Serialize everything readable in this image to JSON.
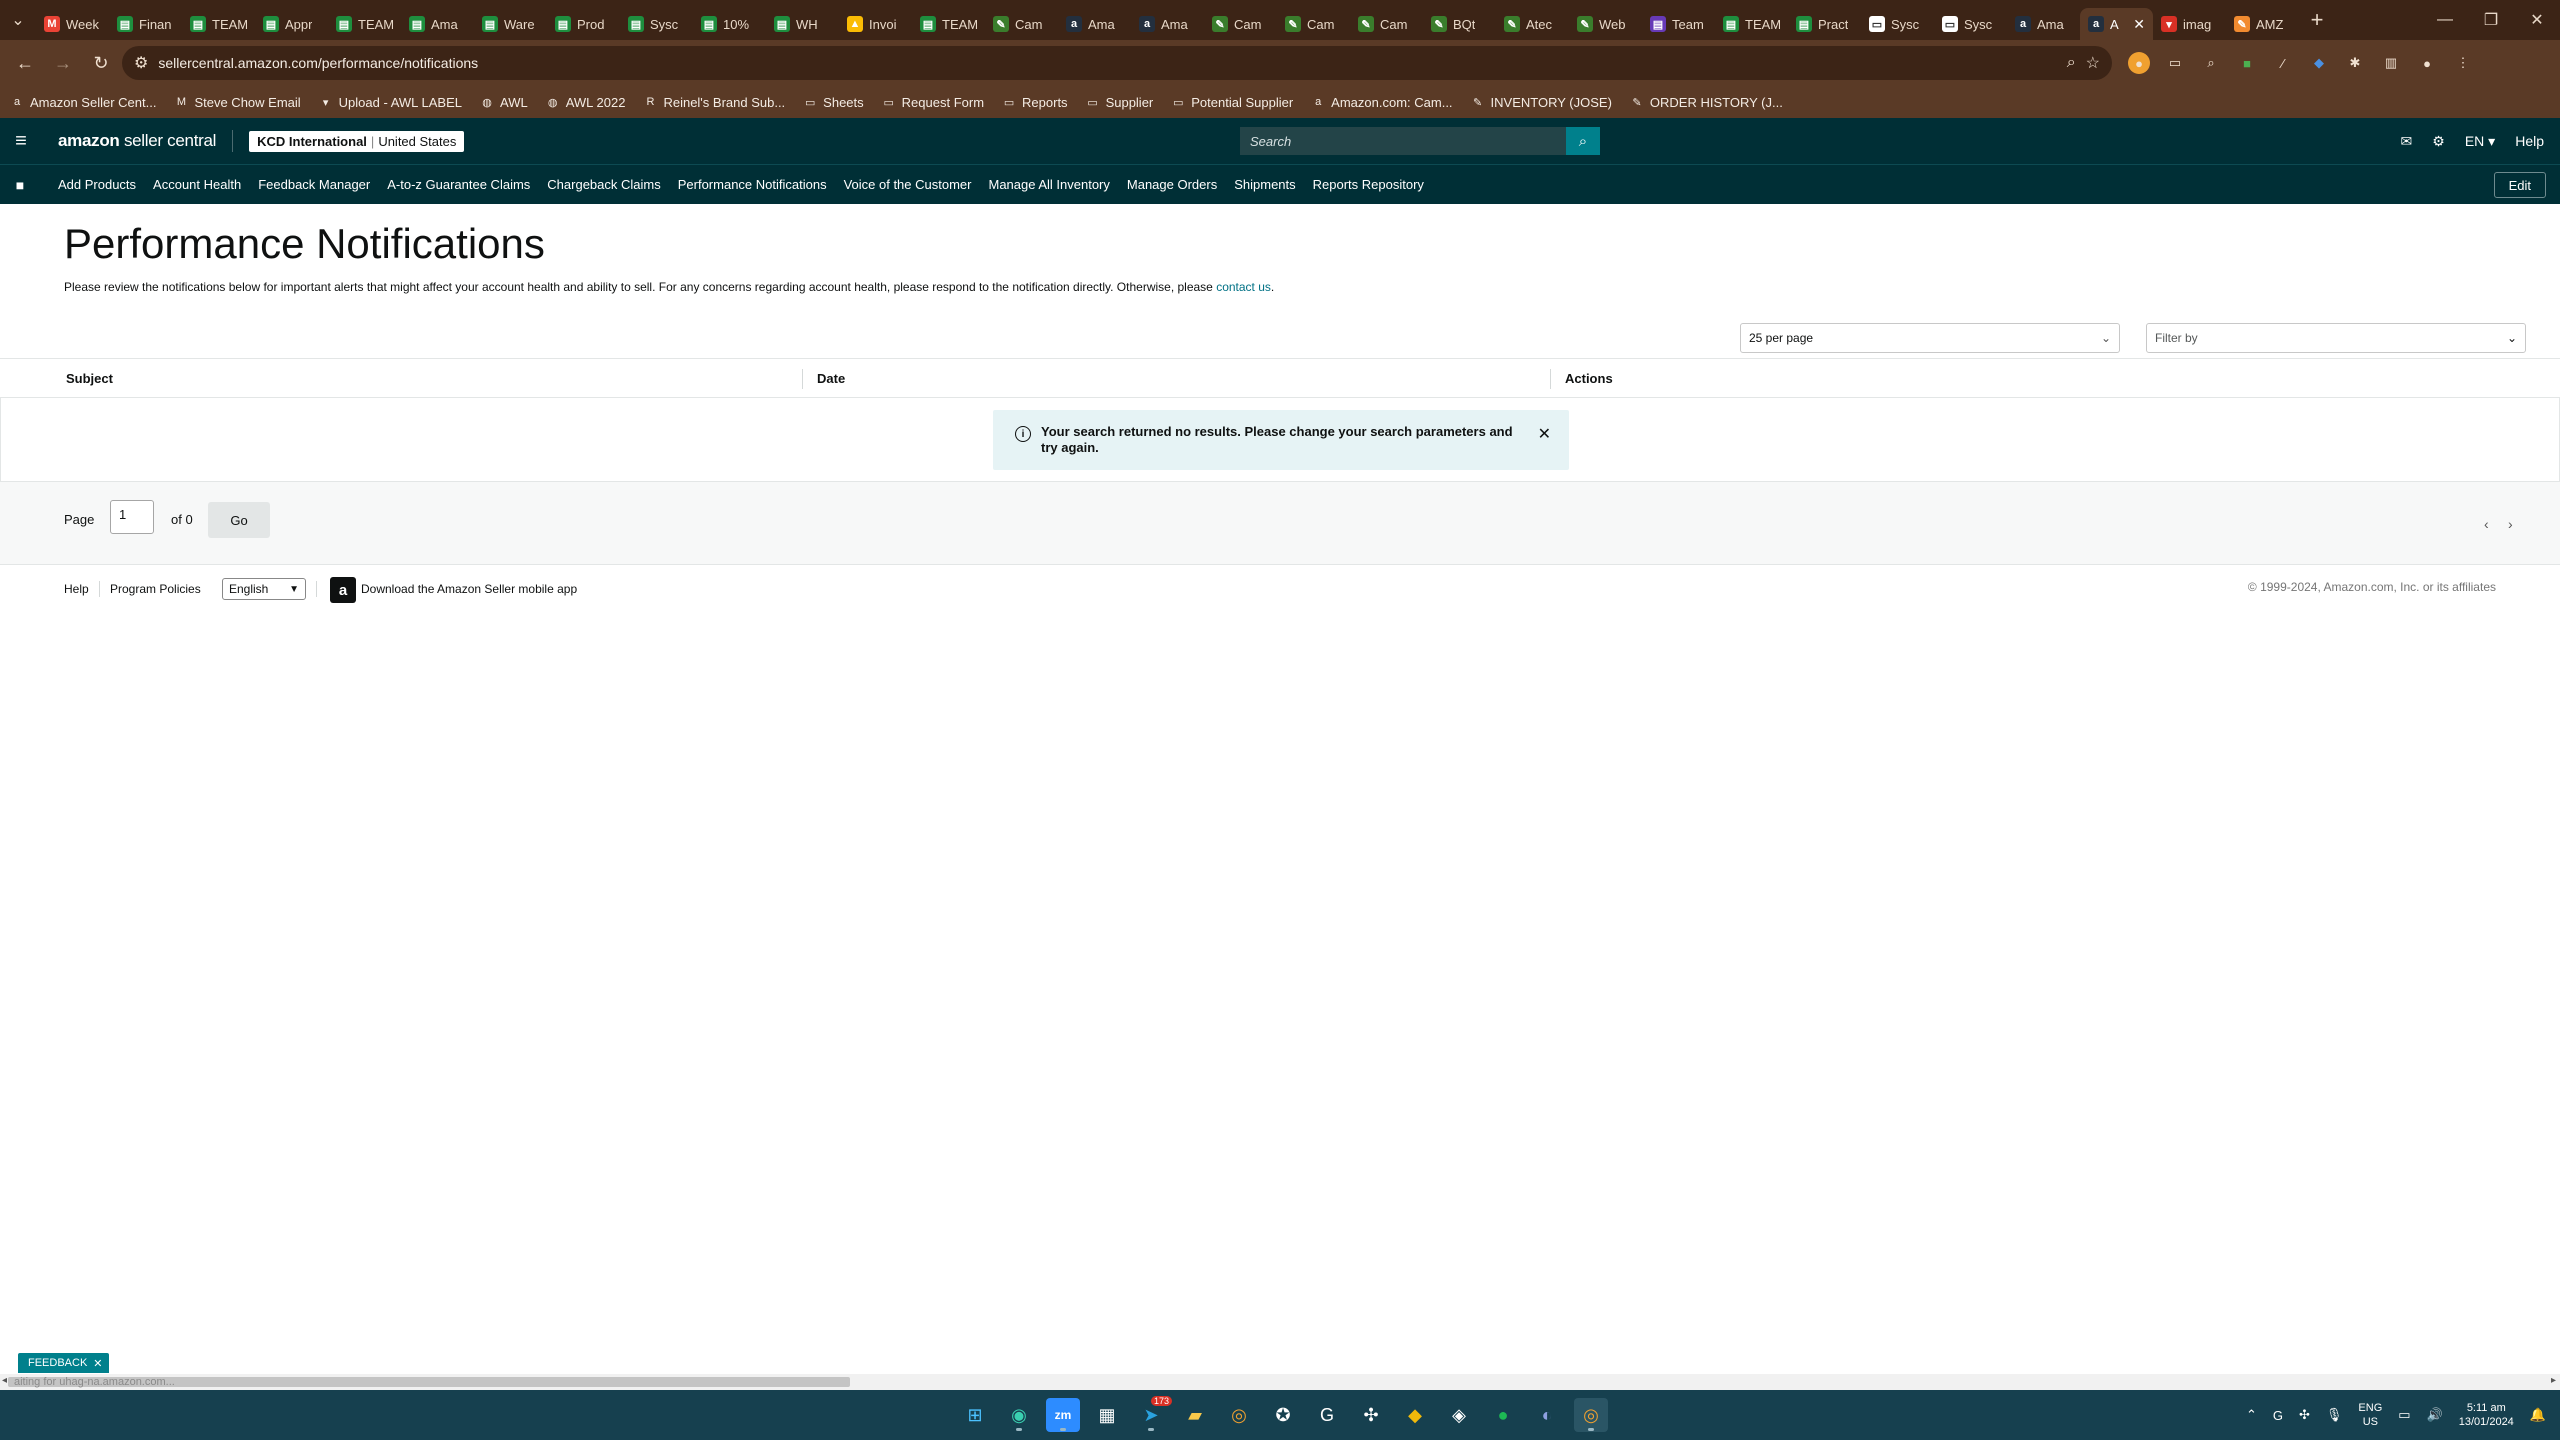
{
  "browser": {
    "tabs": [
      {
        "label": "Week",
        "icon": "gmail-icon",
        "color": "#ea4335"
      },
      {
        "label": "Finan",
        "icon": "sheets-icon",
        "color": "#1e8e3e"
      },
      {
        "label": "TEAM",
        "icon": "sheets-icon",
        "color": "#1e8e3e"
      },
      {
        "label": "Appr",
        "icon": "sheets-icon",
        "color": "#1e8e3e"
      },
      {
        "label": "TEAM",
        "icon": "sheets-icon",
        "color": "#1e8e3e"
      },
      {
        "label": "Ama",
        "icon": "sheets-icon",
        "color": "#1e8e3e"
      },
      {
        "label": "Ware",
        "icon": "sheets-icon",
        "color": "#1e8e3e"
      },
      {
        "label": "Prod",
        "icon": "sheets-icon",
        "color": "#1e8e3e"
      },
      {
        "label": "Sysc",
        "icon": "sheets-icon",
        "color": "#1e8e3e"
      },
      {
        "label": "10%",
        "icon": "sheets-icon",
        "color": "#1e8e3e"
      },
      {
        "label": "WH",
        "icon": "sheets-icon",
        "color": "#1e8e3e"
      },
      {
        "label": "Invoi",
        "icon": "drive-icon",
        "color": "#fbbc04"
      },
      {
        "label": "TEAM",
        "icon": "sheets-icon",
        "color": "#1e8e3e"
      },
      {
        "label": "Cam",
        "icon": "leaf-icon",
        "color": "#3a7d2c"
      },
      {
        "label": "Ama",
        "icon": "amazon-icon",
        "color": "#232f3e"
      },
      {
        "label": "Ama",
        "icon": "amazon-icon",
        "color": "#232f3e"
      },
      {
        "label": "Cam",
        "icon": "leaf-icon",
        "color": "#3a7d2c"
      },
      {
        "label": "Cam",
        "icon": "leaf-icon",
        "color": "#3a7d2c"
      },
      {
        "label": "Cam",
        "icon": "leaf-icon",
        "color": "#3a7d2c"
      },
      {
        "label": "BQt",
        "icon": "leaf-icon",
        "color": "#3a7d2c"
      },
      {
        "label": "Atec",
        "icon": "leaf-icon",
        "color": "#3a7d2c"
      },
      {
        "label": "Web",
        "icon": "leaf-icon",
        "color": "#3a7d2c"
      },
      {
        "label": "Team",
        "icon": "forms-icon",
        "color": "#673ab7"
      },
      {
        "label": "TEAM",
        "icon": "sheets-icon",
        "color": "#1e8e3e"
      },
      {
        "label": "Pract",
        "icon": "sheets-icon",
        "color": "#1e8e3e"
      },
      {
        "label": "Sysc",
        "icon": "doc-icon",
        "color": "#ffffff"
      },
      {
        "label": "Sysc",
        "icon": "doc-icon",
        "color": "#ffffff"
      },
      {
        "label": "Ama",
        "icon": "amazon-icon",
        "color": "#232f3e"
      },
      {
        "label": "A",
        "icon": "amazon-icon",
        "color": "#232f3e",
        "active": true
      },
      {
        "label": "imag",
        "icon": "image-icon",
        "color": "#d93025"
      },
      {
        "label": "AMZ",
        "icon": "pen-icon",
        "color": "#f28b30"
      }
    ],
    "url": "sellercentral.amazon.com/performance/notifications",
    "bookmarks": [
      {
        "label": "Amazon Seller Cent...",
        "icon": "amazon-icon"
      },
      {
        "label": "Steve Chow Email",
        "icon": "gmail-icon"
      },
      {
        "label": "Upload - AWL LABEL",
        "icon": "awl-icon"
      },
      {
        "label": "AWL",
        "icon": "globe-icon"
      },
      {
        "label": "AWL 2022",
        "icon": "globe-icon"
      },
      {
        "label": "Reinel's Brand Sub...",
        "icon": "reinel-icon"
      },
      {
        "label": "Sheets",
        "icon": "folder-icon"
      },
      {
        "label": "Request Form",
        "icon": "folder-icon"
      },
      {
        "label": "Reports",
        "icon": "folder-icon"
      },
      {
        "label": "Supplier",
        "icon": "folder-icon"
      },
      {
        "label": "Potential Supplier",
        "icon": "folder-icon"
      },
      {
        "label": "Amazon.com: Cam...",
        "icon": "amazon-icon"
      },
      {
        "label": "INVENTORY (JOSE)",
        "icon": "pen-icon"
      },
      {
        "label": "ORDER HISTORY (J...",
        "icon": "pen-icon"
      }
    ]
  },
  "header": {
    "logo_main": "amazon",
    "logo_sub": "seller central",
    "account_name": "KCD International",
    "account_region": "United States",
    "search_placeholder": "Search",
    "lang": "EN",
    "help": "Help"
  },
  "nav": {
    "links": [
      "Add Products",
      "Account Health",
      "Feedback Manager",
      "A-to-z Guarantee Claims",
      "Chargeback Claims",
      "Performance Notifications",
      "Voice of the Customer",
      "Manage All Inventory",
      "Manage Orders",
      "Shipments",
      "Reports Repository"
    ],
    "edit_label": "Edit"
  },
  "main": {
    "title": "Performance Notifications",
    "intro": "Please review the notifications below for important alerts that might affect your account health and ability to sell. For any concerns regarding account health, please respond to the notification directly. Otherwise, please ",
    "intro_link": "contact us",
    "intro_end": ".",
    "per_page": "25 per page",
    "filter_placeholder": "Filter by",
    "columns": [
      "Subject",
      "Date",
      "Actions"
    ],
    "alert": "Your search returned no results. Please change your search parameters and try again."
  },
  "pager": {
    "page_label": "Page",
    "page_value": "1",
    "of_label": "of 0",
    "go_label": "Go"
  },
  "footer": {
    "help": "Help",
    "policies": "Program Policies",
    "language": "English",
    "app": "Download the Amazon Seller mobile app",
    "copyright": "© 1999-2024, Amazon.com, Inc. or its affiliates"
  },
  "feedback_label": "FEEDBACK",
  "status_text": "aiting for uhag-na.amazon.com...",
  "taskbar": {
    "tray_lang_1": "ENG",
    "tray_lang_2": "US",
    "time": "5:11 am",
    "date": "13/01/2024",
    "badge": "173"
  }
}
